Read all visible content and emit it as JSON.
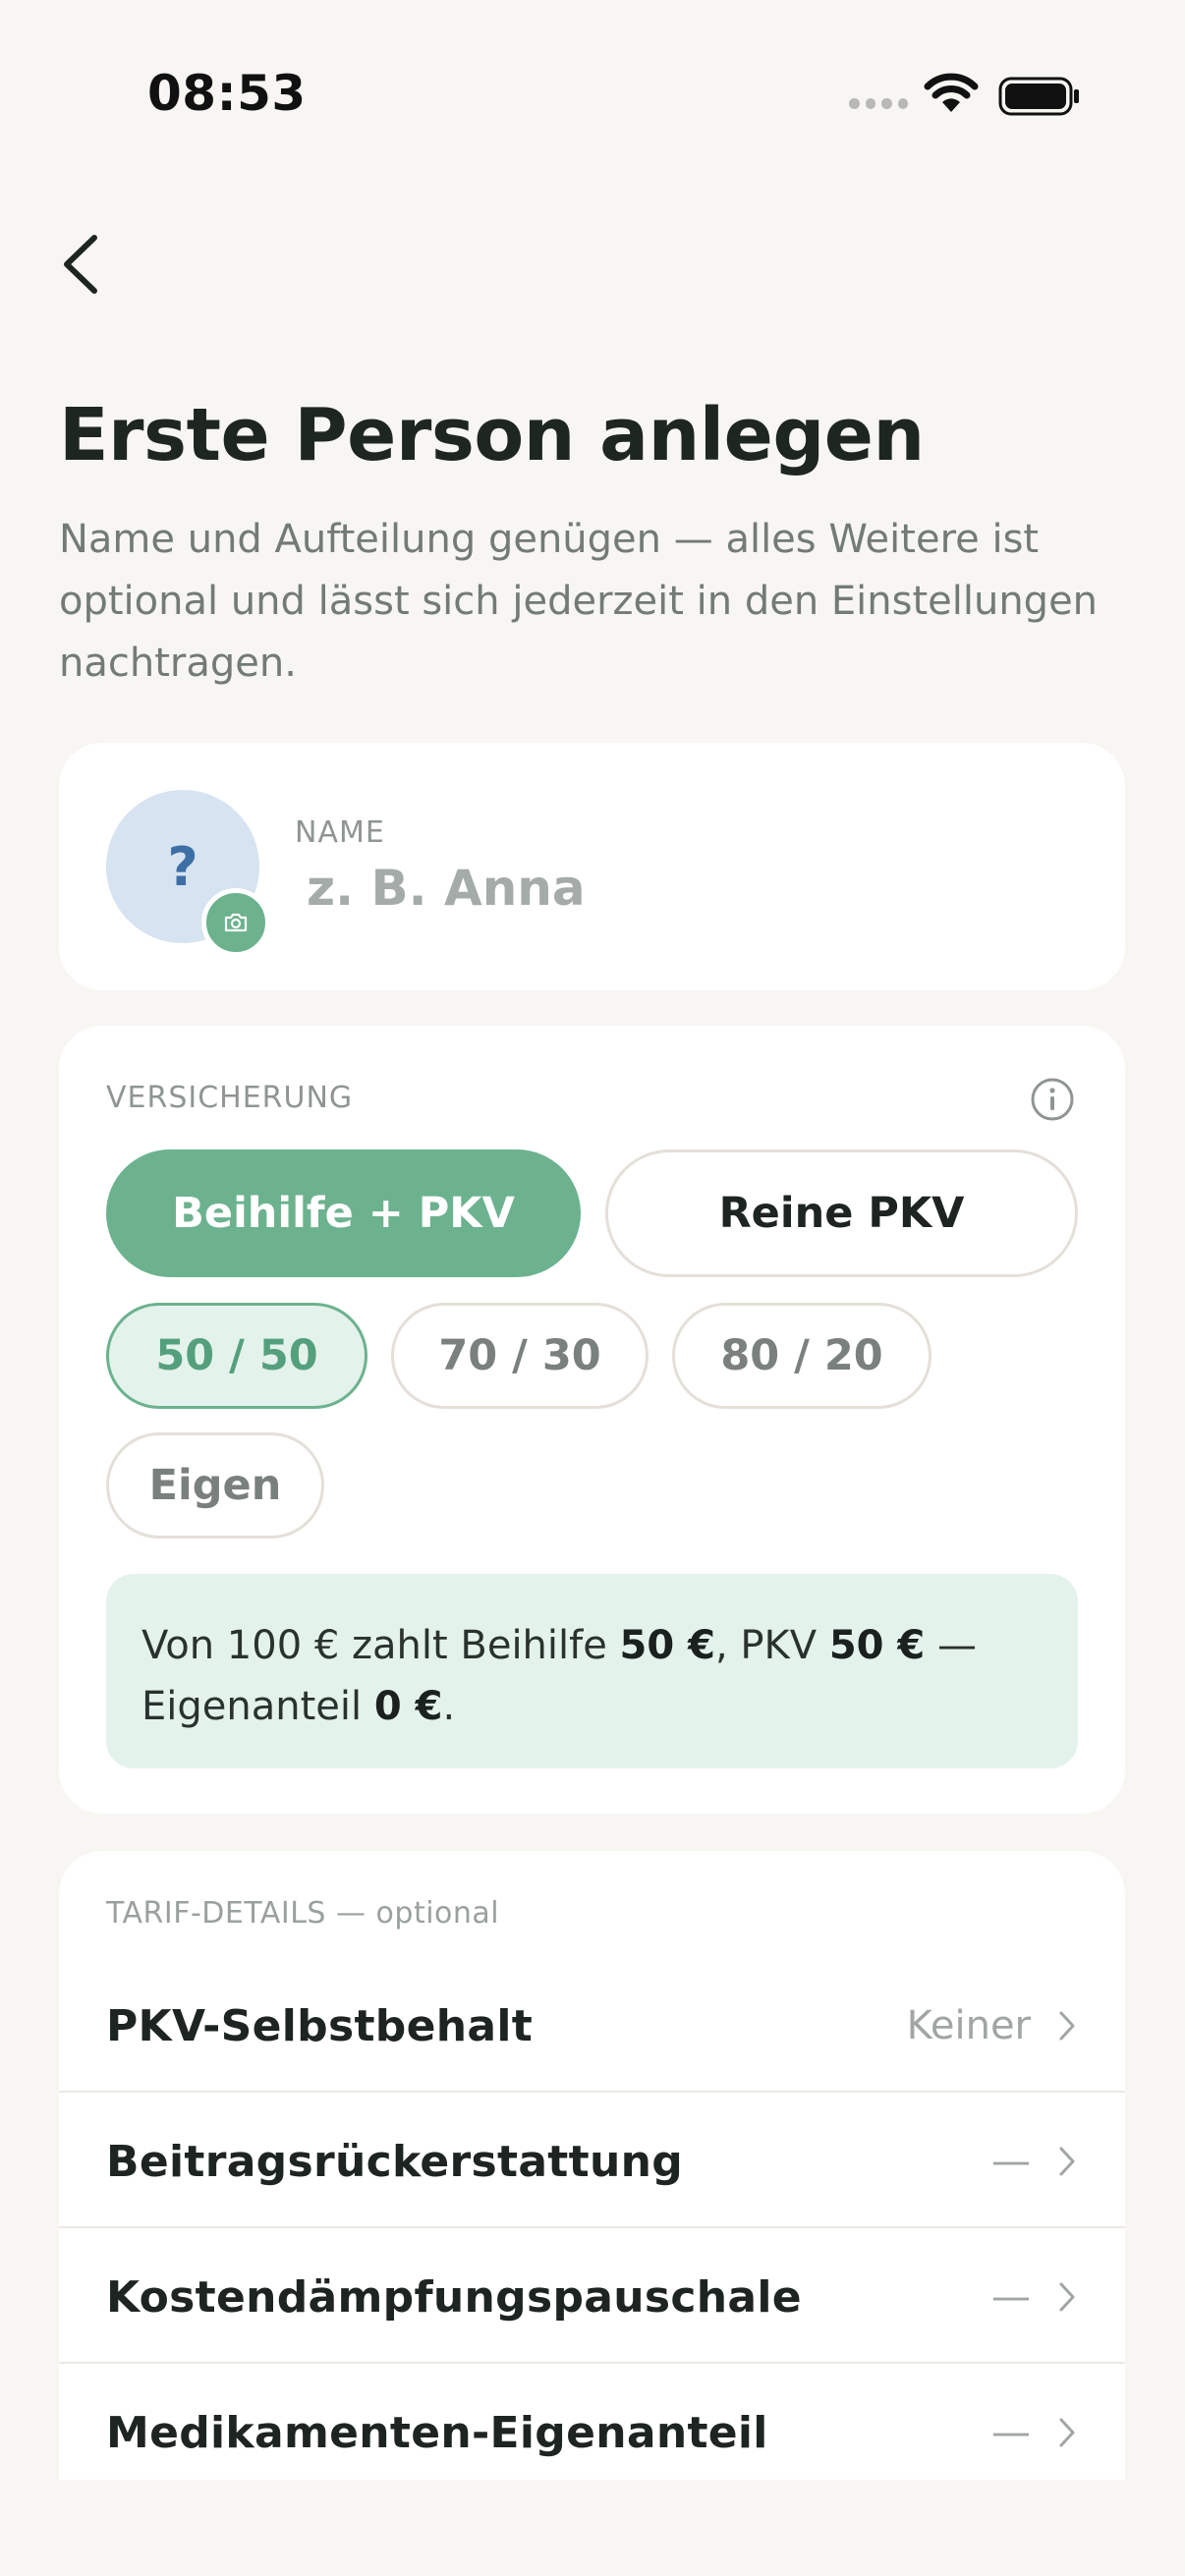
{
  "status_bar": {
    "time": "08:53"
  },
  "header": {
    "title": "Erste Person anlegen",
    "subtitle": "Name und Aufteilung genügen — alles Weitere ist optional und lässt sich jederzeit in den Einstellungen nachtragen."
  },
  "profile": {
    "avatar_placeholder": "?",
    "name_label": "NAME",
    "name_value": "",
    "name_placeholder": "z. B. Anna"
  },
  "insurance": {
    "section_label": "VERSICHERUNG",
    "types": [
      {
        "label": "Beihilfe + PKV",
        "selected": true
      },
      {
        "label": "Reine PKV",
        "selected": false
      }
    ],
    "splits": [
      {
        "label": "50 / 50",
        "selected": true
      },
      {
        "label": "70 / 30",
        "selected": false
      },
      {
        "label": "80 / 20",
        "selected": false
      },
      {
        "label": "Eigen",
        "selected": false
      }
    ],
    "summary": {
      "t1": "Von 100 € zahlt Beihilfe ",
      "beihilfe": "50 €",
      "t2": ", PKV ",
      "pkv": "50 €",
      "t3": " — Eigenanteil ",
      "eigen": "0 €",
      "t4": "."
    }
  },
  "tarif": {
    "section_label": "TARIF-DETAILS — optional",
    "rows": [
      {
        "label": "PKV-Selbstbehalt",
        "value": "Keiner"
      },
      {
        "label": "Beitragsrückerstattung",
        "value": "—"
      },
      {
        "label": "Kostendämpfungspauschale",
        "value": "—"
      },
      {
        "label": "Medikamenten-Eigenanteil",
        "value": "—"
      }
    ]
  },
  "colors": {
    "accent": "#6cb28f",
    "accent_soft": "#e4f2ec",
    "background": "#f8f6f2",
    "card": "#ffffff",
    "avatar_bg": "#d6e3f0"
  }
}
